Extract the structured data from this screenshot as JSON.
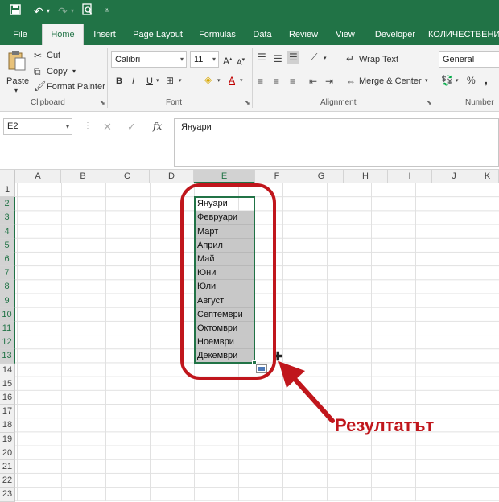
{
  "quick_access": {
    "save_icon": "save-icon",
    "undo_icon": "undo-icon",
    "redo_icon": "redo-icon",
    "print_preview_icon": "print-preview-icon"
  },
  "tabs": [
    {
      "label": "File"
    },
    {
      "label": "Home",
      "active": true
    },
    {
      "label": "Insert"
    },
    {
      "label": "Page Layout"
    },
    {
      "label": "Formulas"
    },
    {
      "label": "Data"
    },
    {
      "label": "Review"
    },
    {
      "label": "View"
    },
    {
      "label": "Developer"
    },
    {
      "label": "КОЛИЧЕСТВЕНИ"
    }
  ],
  "ribbon": {
    "clipboard": {
      "paste": "Paste",
      "cut": "Cut",
      "copy": "Copy",
      "format_painter": "Format Painter",
      "label": "Clipboard"
    },
    "font": {
      "name": "Calibri",
      "size": "11",
      "bold": "B",
      "italic": "I",
      "underline": "U",
      "label": "Font",
      "grow": "A",
      "shrink": "A",
      "font_color": "A"
    },
    "alignment": {
      "wrap_text": "Wrap Text",
      "merge_center": "Merge & Center",
      "label": "Alignment"
    },
    "number": {
      "format": "General",
      "label": "Number",
      "percent": "%",
      "comma": ","
    }
  },
  "formula_bar": {
    "name_box": "E2",
    "fx": "fx",
    "value": "Януари",
    "cancel": "✕",
    "enter": "✓"
  },
  "columns": [
    "A",
    "B",
    "C",
    "D",
    "E",
    "F",
    "G",
    "H",
    "I",
    "J",
    "K"
  ],
  "selected_column": "E",
  "rows": [
    "1",
    "2",
    "3",
    "4",
    "5",
    "6",
    "7",
    "8",
    "9",
    "10",
    "11",
    "12",
    "13",
    "14",
    "15",
    "16",
    "17",
    "18",
    "19",
    "20",
    "21",
    "22",
    "23"
  ],
  "cells_e": [
    {
      "row": 2,
      "value": "Януари"
    },
    {
      "row": 3,
      "value": "Февруари"
    },
    {
      "row": 4,
      "value": "Март"
    },
    {
      "row": 5,
      "value": "Април"
    },
    {
      "row": 6,
      "value": "Май"
    },
    {
      "row": 7,
      "value": "Юни"
    },
    {
      "row": 8,
      "value": "Юли"
    },
    {
      "row": 9,
      "value": "Август"
    },
    {
      "row": 10,
      "value": "Септември"
    },
    {
      "row": 11,
      "value": "Октомври"
    },
    {
      "row": 12,
      "value": "Ноември"
    },
    {
      "row": 13,
      "value": "Декември"
    }
  ],
  "annotation": {
    "text": "Резултатът",
    "color": "#c0161c"
  },
  "colors": {
    "brand": "#217346"
  }
}
